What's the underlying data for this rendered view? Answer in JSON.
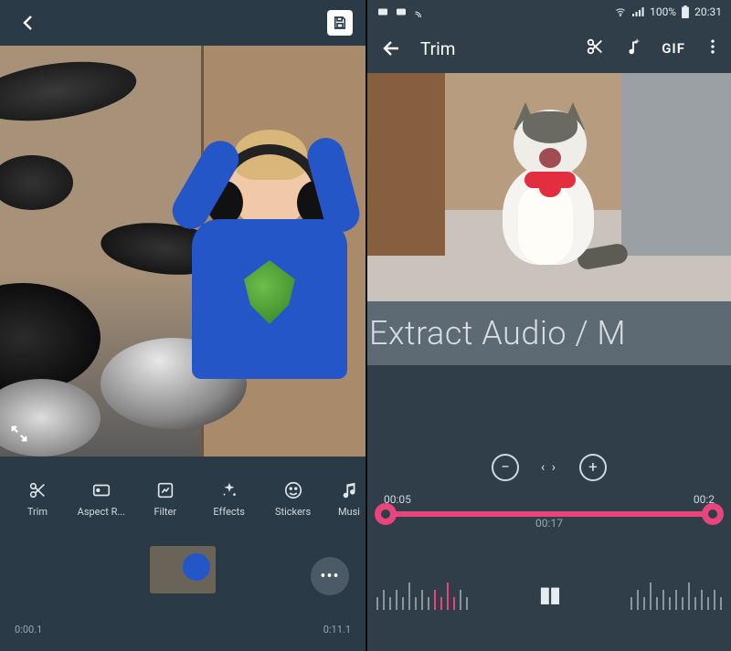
{
  "left": {
    "tools": [
      {
        "label": "Trim",
        "icon": "scissors-icon"
      },
      {
        "label": "Aspect R...",
        "icon": "aspect-icon"
      },
      {
        "label": "Filter",
        "icon": "filter-icon"
      },
      {
        "label": "Effects",
        "icon": "sparkle-icon"
      },
      {
        "label": "Stickers",
        "icon": "smile-icon"
      },
      {
        "label": "Musi",
        "icon": "music-icon"
      }
    ],
    "timestamp_start": "0:00.1",
    "timestamp_end": "0:11.1"
  },
  "right": {
    "status": {
      "battery": "100%",
      "time": "20:31"
    },
    "title": "Trim",
    "gif_label": "GIF",
    "overlay_text": "Extract Audio / M",
    "trim_start": "00:05",
    "trim_end": "00:2",
    "trim_mid": "00:17"
  }
}
